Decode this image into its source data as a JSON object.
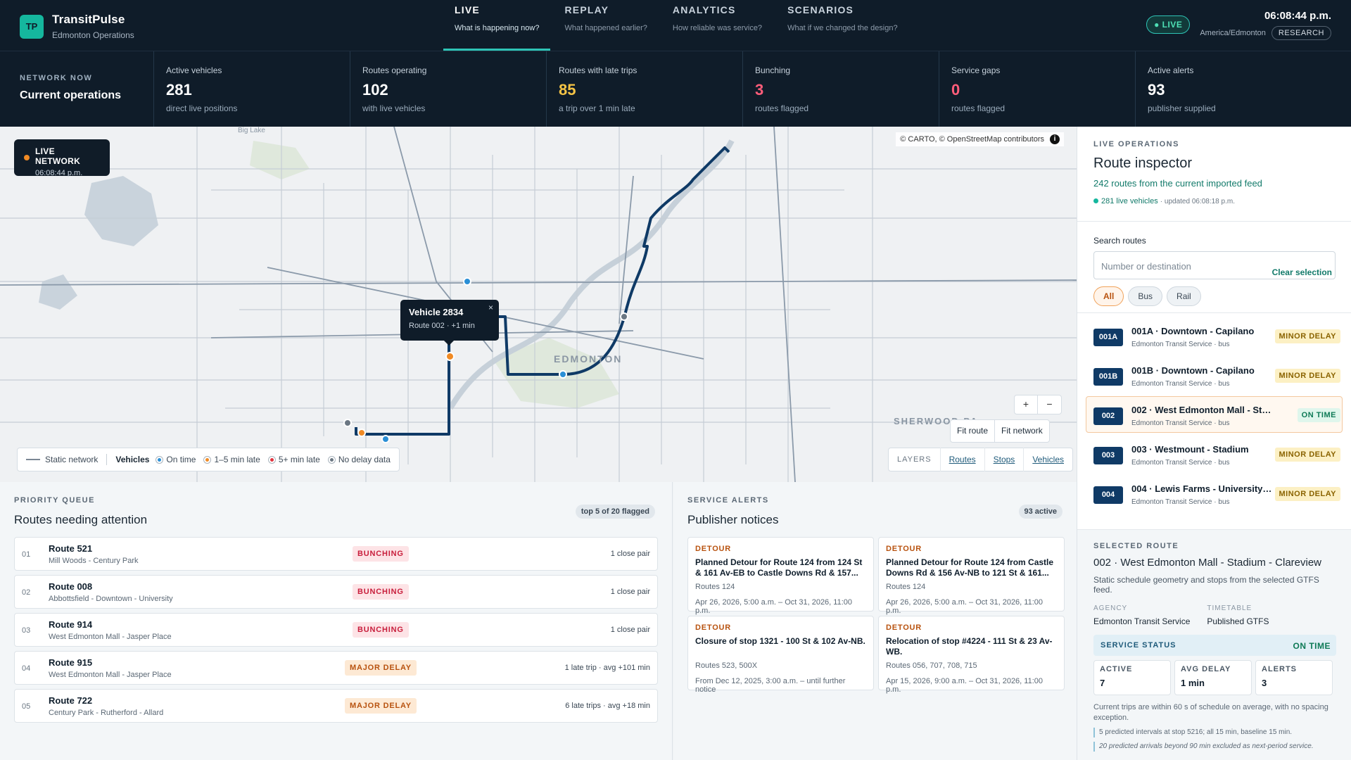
{
  "brand": {
    "logo": "TP",
    "name": "TransitPulse",
    "sub": "Edmonton Operations"
  },
  "nav": [
    {
      "title": "LIVE",
      "sub": "What is happening now?",
      "active": true
    },
    {
      "title": "REPLAY",
      "sub": "What happened earlier?"
    },
    {
      "title": "ANALYTICS",
      "sub": "How reliable was service?"
    },
    {
      "title": "SCENARIOS",
      "sub": "What if we changed the design?"
    }
  ],
  "header": {
    "live": "● LIVE",
    "time": "06:08:44 p.m.",
    "tz": "America/Edmonton",
    "research": "RESEARCH"
  },
  "network": {
    "kicker": "NETWORK NOW",
    "title": "Current operations"
  },
  "stats": [
    {
      "label": "Active vehicles",
      "value": "281",
      "desc": "direct live positions"
    },
    {
      "label": "Routes operating",
      "value": "102",
      "desc": "with live vehicles"
    },
    {
      "label": "Routes with late trips",
      "value": "85",
      "desc": "a trip over 1 min late",
      "color": "#f6c445"
    },
    {
      "label": "Bunching",
      "value": "3",
      "desc": "routes flagged",
      "color": "#ff5d7a"
    },
    {
      "label": "Service gaps",
      "value": "0",
      "desc": "routes flagged",
      "color": "#ff5d7a"
    },
    {
      "label": "Active alerts",
      "value": "93",
      "desc": "publisher supplied"
    }
  ],
  "map": {
    "live_title": "LIVE NETWORK",
    "live_time": "06:08:44 p.m.",
    "attribution": "© CARTO, © OpenStreetMap contributors",
    "info_icon": "i",
    "popup": {
      "title": "Vehicle 2834",
      "sub": "Route 002 · +1 min",
      "close": "×"
    },
    "labels": {
      "city": "EDMONTON",
      "sherwood": "SHERWOOD PA",
      "bigLake": "Big Lake"
    },
    "zoom_in": "+",
    "zoom_out": "−",
    "fit_route": "Fit route",
    "fit_network": "Fit network",
    "layers": {
      "title": "LAYERS",
      "routes": "Routes",
      "stops": "Stops",
      "vehicles": "Vehicles"
    },
    "legend": {
      "static": "Static network",
      "vehicles": "Vehicles",
      "on_time": "On time",
      "late1": "1–5 min late",
      "late5": "5+ min late",
      "nodata": "No delay data"
    },
    "colors": {
      "route": "#0f3a66",
      "on_time": "#2a8fd6",
      "late1": "#f08a24",
      "late5": "#e2343f",
      "nodata": "#6b7783"
    }
  },
  "priority": {
    "kicker": "PRIORITY QUEUE",
    "title": "Routes needing attention",
    "badge": "top 5 of 20 flagged",
    "rows": [
      {
        "num": "01",
        "route": "Route 521",
        "desc": "Mill Woods - Century Park",
        "badge": "BUNCHING",
        "detail": "1 close pair"
      },
      {
        "num": "02",
        "route": "Route 008",
        "desc": "Abbottsfield - Downtown - University",
        "badge": "BUNCHING",
        "detail": "1 close pair"
      },
      {
        "num": "03",
        "route": "Route 914",
        "desc": "West Edmonton Mall - Jasper Place",
        "badge": "BUNCHING",
        "detail": "1 close pair"
      },
      {
        "num": "04",
        "route": "Route 915",
        "desc": "West Edmonton Mall - Jasper Place",
        "badge": "MAJOR DELAY",
        "detail": "1 late trip · avg +101 min"
      },
      {
        "num": "05",
        "route": "Route 722",
        "desc": "Century Park - Rutherford - Allard",
        "badge": "MAJOR DELAY",
        "detail": "6 late trips · avg +18 min"
      }
    ]
  },
  "alerts": {
    "kicker": "SERVICE ALERTS",
    "title": "Publisher notices",
    "badge": "93 active",
    "items": [
      {
        "type": "DETOUR",
        "title": "Planned Detour for Route 124 from 124 St & 161 Av-EB to Castle Downs Rd & 157...",
        "routes": "Routes 124",
        "dates": "Apr 26, 2026, 5:00 a.m. – Oct 31, 2026, 11:00 p.m."
      },
      {
        "type": "DETOUR",
        "title": "Planned Detour for Route 124 from Castle Downs Rd & 156 Av-NB to 121 St & 161...",
        "routes": "Routes 124",
        "dates": "Apr 26, 2026, 5:00 a.m. – Oct 31, 2026, 11:00 p.m."
      },
      {
        "type": "DETOUR",
        "title": "Closure of stop 1321 - 100 St & 102 Av-NB.",
        "routes": "Routes 523, 500X",
        "dates": "From Dec 12, 2025, 3:00 a.m. – until further notice"
      },
      {
        "type": "DETOUR",
        "title": "Relocation of stop #4224 - 111 St & 23 Av-WB.",
        "routes": "Routes 056, 707, 708, 715",
        "dates": "Apr 15, 2026, 9:00 a.m. – Oct 31, 2026, 11:00 p.m."
      }
    ]
  },
  "inspector": {
    "kicker": "LIVE OPERATIONS",
    "title": "Route inspector",
    "sub": "242 routes from the current imported feed",
    "live": "281 live vehicles",
    "updated": "· updated 06:08:18 p.m.",
    "search_label": "Search routes",
    "search_placeholder": "Number or destination",
    "clear": "Clear selection",
    "filters": [
      "All",
      "Bus",
      "Rail"
    ],
    "routes": [
      {
        "code": "001A",
        "title": "001A · Downtown - Capilano",
        "sub": "Edmonton Transit Service · bus",
        "status": "MINOR DELAY"
      },
      {
        "code": "001B",
        "title": "001B · Downtown - Capilano",
        "sub": "Edmonton Transit Service · bus",
        "status": "MINOR DELAY"
      },
      {
        "code": "002",
        "title": "002 · West Edmonton Mall - Stadium - Clareview",
        "sub": "Edmonton Transit Service · bus",
        "status": "ON TIME",
        "selected": true
      },
      {
        "code": "003",
        "title": "003 · Westmount - Stadium",
        "sub": "Edmonton Transit Service · bus",
        "status": "MINOR DELAY"
      },
      {
        "code": "004",
        "title": "004 · Lewis Farms - University Station",
        "sub": "Edmonton Transit Service · bus",
        "status": "MINOR DELAY"
      }
    ]
  },
  "selected": {
    "kicker": "SELECTED ROUTE",
    "title": "002 · West Edmonton Mall - Stadium - Clareview",
    "desc": "Static schedule geometry and stops from the selected GTFS feed.",
    "agency_k": "AGENCY",
    "agency_v": "Edmonton Transit Service",
    "timetable_k": "TIMETABLE",
    "timetable_v": "Published GTFS",
    "service_k": "SERVICE STATUS",
    "service_v": "ON TIME",
    "active_k": "ACTIVE",
    "active_v": "7",
    "delay_k": "AVG DELAY",
    "delay_v": "1 min",
    "alerts_k": "ALERTS",
    "alerts_v": "3",
    "note": "Current trips are within 60 s of schedule on average, with no spacing exception.",
    "note2": "5 predicted intervals at stop 5216; all 15 min, baseline 15 min.",
    "note3": "20 predicted arrivals beyond 90 min excluded as next-period service."
  }
}
